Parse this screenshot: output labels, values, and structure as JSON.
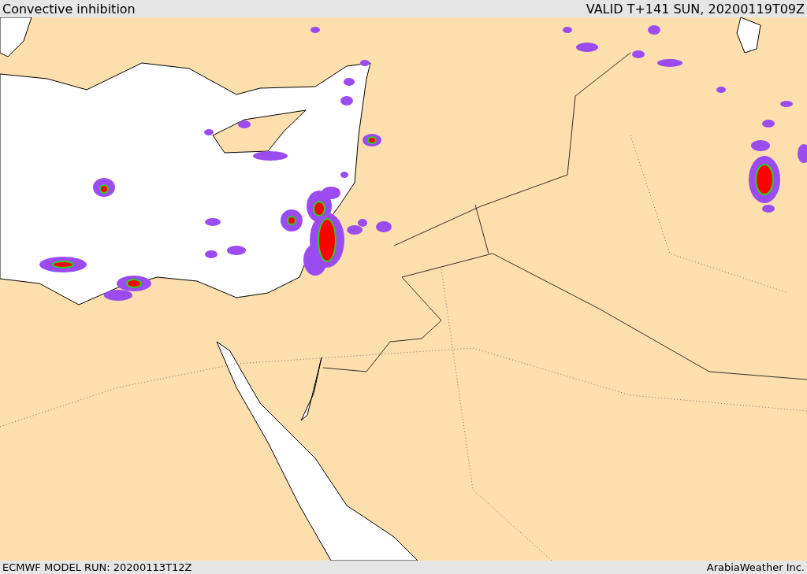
{
  "header": {
    "title": "Convective inhibition",
    "valid": "VALID T+141 SUN, 20200119T09Z"
  },
  "footer": {
    "model_run": "ECMWF MODEL RUN: 20200113T12Z",
    "credit": "ArabiaWeather Inc."
  }
}
